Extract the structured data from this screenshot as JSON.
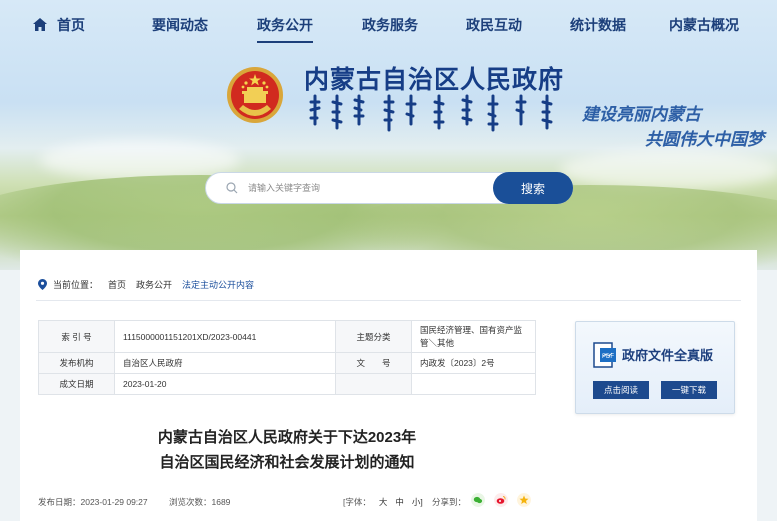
{
  "nav": {
    "home": "首页",
    "items": [
      "要闻动态",
      "政务公开",
      "政务服务",
      "政民互动",
      "统计数据",
      "内蒙古概况"
    ],
    "active": "政务公开"
  },
  "header": {
    "title": "内蒙古自治区人民政府",
    "slogan_line1": "建设亮丽内蒙古",
    "slogan_line2": "共圆伟大中国梦"
  },
  "search": {
    "placeholder": "请输入关键字查询",
    "button": "搜索"
  },
  "breadcrumb": {
    "label": "当前位置：",
    "items": [
      "首页",
      "政务公开",
      "法定主动公开内容"
    ]
  },
  "meta": {
    "index_label": "索 引 号",
    "index_value": "11150000011512​01XD/2023-00441",
    "topic_label": "主题分类",
    "topic_value": "国民经济管理、国有资产监管＼其他",
    "issuer_label": "发布机构",
    "issuer_value": "自治区人民政府",
    "docno_label": "文　　号",
    "docno_value": "内政发〔2023〕2号",
    "date_label": "成文日期",
    "date_value": "2023-01-20"
  },
  "widget": {
    "title": "政府文件全真版",
    "read_button": "点击阅读",
    "download_button": "一键下载"
  },
  "article": {
    "title_line1": "内蒙古自治区人民政府关于下达2023年",
    "title_line2": "自治区国民经济和社会发展计划的通知"
  },
  "info": {
    "publish": "发布日期：2023-01-29 09:27",
    "views": "浏览次数：1689",
    "font_label": "[字体：",
    "font_large": "大",
    "font_medium": "中",
    "font_small": "小]",
    "share_label": "分享到："
  },
  "colors": {
    "brand_blue": "#1a4f98",
    "nav_text": "#1c3f7a"
  }
}
